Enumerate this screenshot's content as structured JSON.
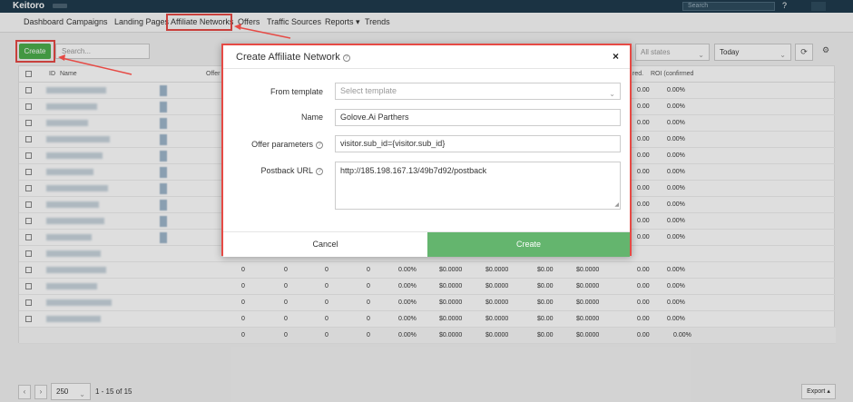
{
  "brand": {
    "logo": "Keitoro"
  },
  "topbar": {
    "search_placeholder": "Search",
    "help": "?"
  },
  "nav": {
    "items": [
      "Dashboard",
      "Campaigns",
      "Landing Pages",
      "Affiliate Networks",
      "Offers",
      "Traffic Sources",
      "Reports ▾",
      "Trends"
    ]
  },
  "toolbar": {
    "create_label": "Create",
    "search_placeholder": "Search...",
    "states_value": "All states",
    "date_value": "Today"
  },
  "table": {
    "headers": {
      "id": "ID",
      "name": "Name",
      "offers": "Offer",
      "revenue": "red.",
      "roi": "ROI (confirmed"
    },
    "rows_top": [
      {
        "rev": "0.00",
        "roi": "0.00%"
      },
      {
        "rev": "0.00",
        "roi": "0.00%"
      },
      {
        "rev": "0.00",
        "roi": "0.00%"
      },
      {
        "rev": "0.00",
        "roi": "0.00%"
      },
      {
        "rev": "0.00",
        "roi": "0.00%"
      },
      {
        "rev": "0.00",
        "roi": "0.00%"
      },
      {
        "rev": "0.00",
        "roi": "0.00%"
      },
      {
        "rev": "0.00",
        "roi": "0.00%"
      },
      {
        "rev": "0.00",
        "roi": "0.00%"
      },
      {
        "rev": "0.00",
        "roi": "0.00%"
      }
    ],
    "rows_full": [
      [
        "0",
        "0",
        "0",
        "0",
        "0.00%",
        "$0.0000",
        "$0.0000",
        "$0.00",
        "$0.0000",
        "0.00",
        "0.00%"
      ],
      [
        "0",
        "0",
        "0",
        "0",
        "0.00%",
        "$0.0000",
        "$0.0000",
        "$0.00",
        "$0.0000",
        "0.00",
        "0.00%"
      ],
      [
        "0",
        "0",
        "0",
        "0",
        "0.00%",
        "$0.0000",
        "$0.0000",
        "$0.00",
        "$0.0000",
        "0.00",
        "0.00%"
      ],
      [
        "0",
        "0",
        "0",
        "0",
        "0.00%",
        "$0.0000",
        "$0.0000",
        "$0.00",
        "$0.0000",
        "0.00",
        "0.00%"
      ]
    ],
    "total": [
      "0",
      "0",
      "0",
      "0",
      "0.00%",
      "$0.0000",
      "$0.0000",
      "$0.00",
      "$0.0000",
      "0.00",
      "0.00%"
    ]
  },
  "pager": {
    "prev": "‹",
    "next": "›",
    "per_page": "250",
    "info": "1 - 15 of 15",
    "export": "Export ▴"
  },
  "modal": {
    "title": "Create Affiliate Network",
    "close": "×",
    "from_template_label": "From template",
    "from_template_placeholder": "Select template",
    "name_label": "Name",
    "name_value": "Golove.Ai Parthers",
    "offer_params_label": "Offer parameters",
    "offer_params_value": "visitor.sub_id={visitor.sub_id}",
    "postback_label": "Postback URL",
    "postback_value": "http://185.198.167.13/49b7d92/postback",
    "cancel_label": "Cancel",
    "create_label": "Create"
  },
  "colors": {
    "accent_red": "#e64a45",
    "create_green": "#64b56e",
    "topbar": "#1f3b4d"
  }
}
